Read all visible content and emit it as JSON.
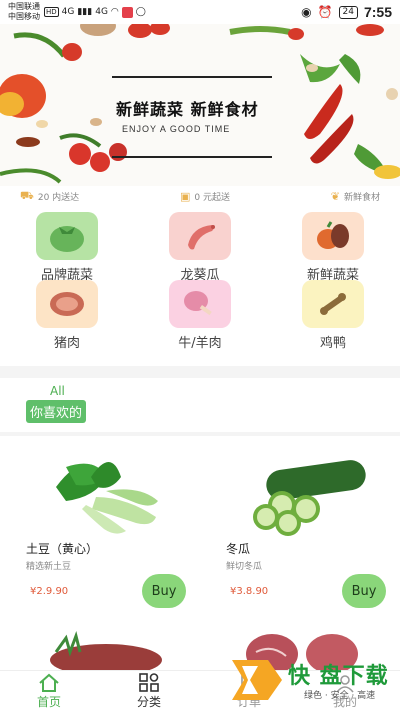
{
  "status_bar": {
    "carrier1": "中国联通",
    "carrier2": "中国移动",
    "net_badge1": "HD",
    "net_badge2": "HD",
    "net1": "4G",
    "net2": "4G",
    "battery": "24",
    "time": "7:55"
  },
  "banner": {
    "title": "新鲜蔬菜 新鲜食材",
    "subtitle": "ENJOY A GOOD TIME"
  },
  "features": [
    {
      "icon": "truck-icon",
      "label": "20 内送达"
    },
    {
      "icon": "wallet-icon",
      "label": "0 元起送"
    },
    {
      "icon": "leaf-icon",
      "label": "新鲜食材"
    }
  ],
  "categories": [
    {
      "label": "品牌蔬菜",
      "icon": "tomato-icon",
      "color": "#b6e3a4"
    },
    {
      "label": "龙葵瓜",
      "icon": "sausage-icon",
      "color": "#f9d2cf"
    },
    {
      "label": "新鲜蔬菜",
      "icon": "vegetables-icon",
      "color": "#fde0cc"
    },
    {
      "label": "猪肉",
      "icon": "steak-icon",
      "color": "#fde4c6"
    },
    {
      "label": "牛/羊肉",
      "icon": "drumstick-icon",
      "color": "#fbd1e2"
    },
    {
      "label": "鸡鸭",
      "icon": "bone-icon",
      "color": "#fbf3c0"
    }
  ],
  "section": {
    "tab_all": "All",
    "tab_like": "你喜欢的"
  },
  "products": [
    {
      "name": "土豆（黄心）",
      "desc": "精选新土豆",
      "price": "¥2.9.90",
      "buy": "Buy",
      "image": "bok-choy"
    },
    {
      "name": "冬瓜",
      "desc": "鲜切冬瓜",
      "price": "¥3.8.90",
      "buy": "Buy",
      "image": "cucumber"
    }
  ],
  "tabbar": {
    "home": "首页",
    "category": "分类",
    "orders": "订单",
    "mine": "我的"
  },
  "watermark": {
    "brand": "快 盘下载",
    "slogan": "绿色 · 安全 · 高速"
  },
  "colors": {
    "accent_green": "#5fbf6a",
    "buy_green": "#8ad67a",
    "price_red": "#e05a3a",
    "feature_orange": "#e9b14f"
  }
}
